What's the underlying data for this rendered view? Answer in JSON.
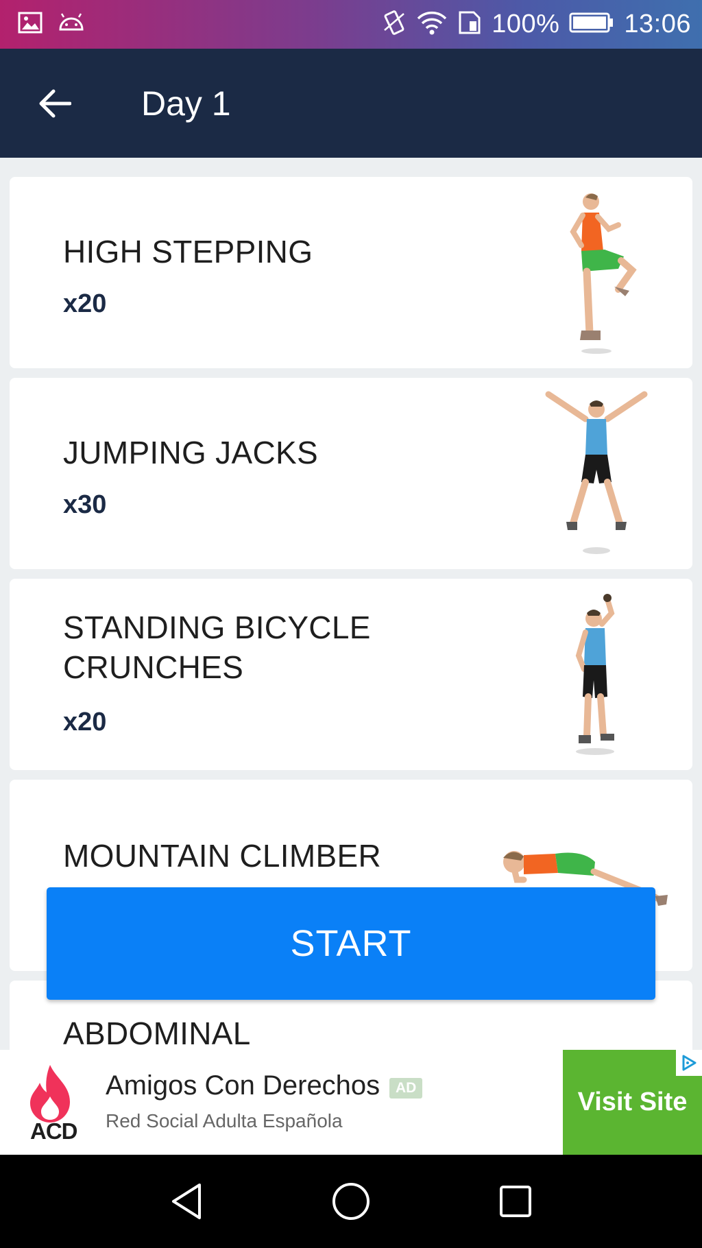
{
  "status_bar": {
    "battery_percent": "100%",
    "time": "13:06",
    "icons": [
      "image-icon",
      "android-icon",
      "vibrate-icon",
      "wifi-icon",
      "sim-icon",
      "battery-icon"
    ]
  },
  "header": {
    "title": "Day 1",
    "back_icon": "arrow-left-icon",
    "background": "#1b2a45"
  },
  "exercises": [
    {
      "name": "HIGH STEPPING",
      "reps": "x20"
    },
    {
      "name": "JUMPING JACKS",
      "reps": "x30"
    },
    {
      "name": "STANDING BICYCLE CRUNCHES",
      "reps": "x20"
    },
    {
      "name": "MOUNTAIN CLIMBER",
      "reps": ""
    },
    {
      "name": "ABDOMINAL",
      "reps": ""
    }
  ],
  "start_button": {
    "label": "START",
    "color": "#0a80f7"
  },
  "ad": {
    "logo_text": "ACD",
    "title": "Amigos Con Derechos",
    "badge": "AD",
    "subtitle": "Red Social Adulta Española",
    "cta": "Visit Site",
    "cta_color": "#5bb531"
  },
  "nav_bar": {
    "buttons": [
      "back-triangle-icon",
      "home-circle-icon",
      "recents-square-icon"
    ]
  }
}
